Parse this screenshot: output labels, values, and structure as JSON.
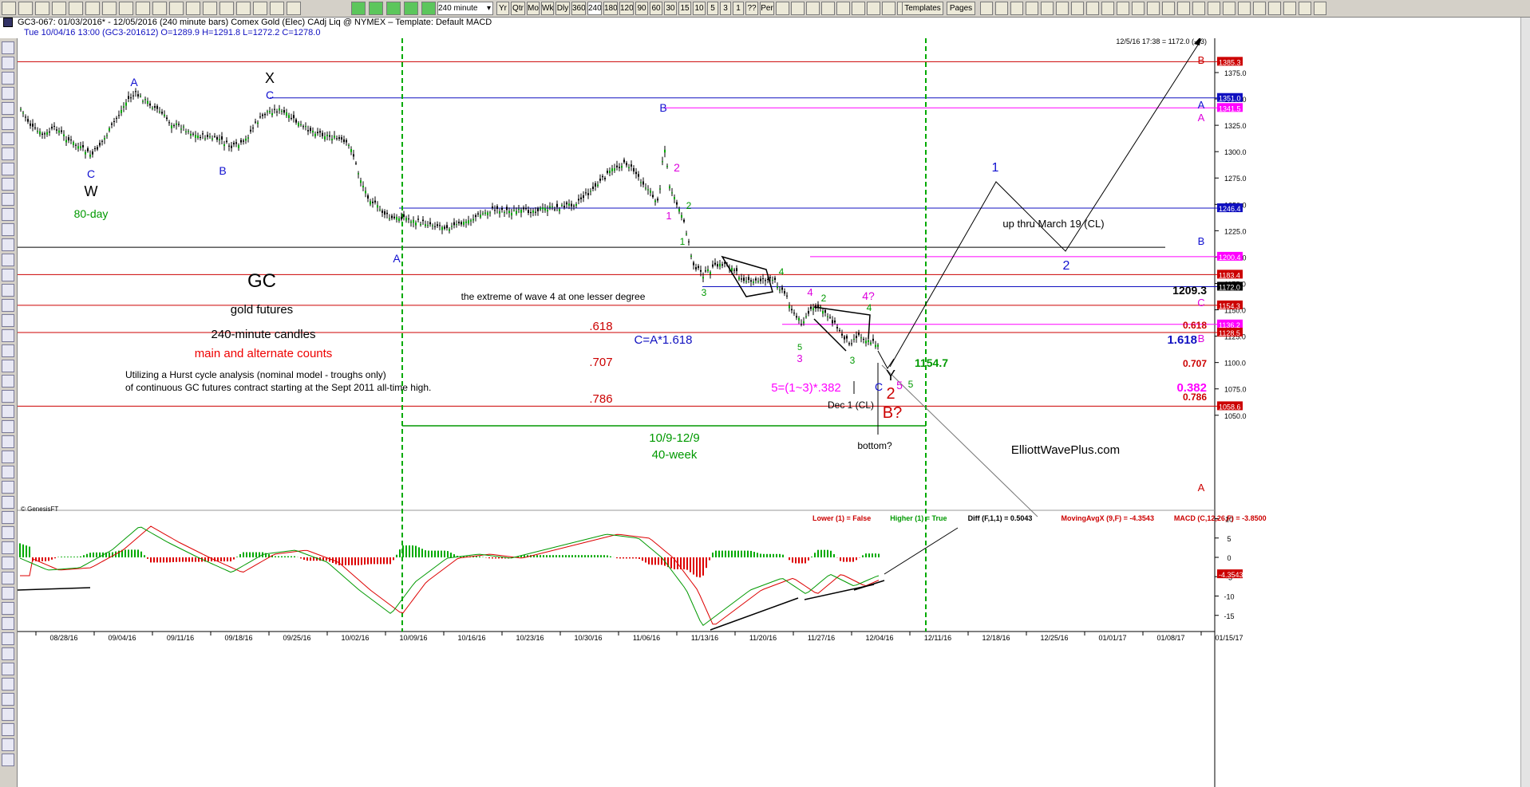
{
  "toolbar": {
    "interval_select": "240 minute",
    "period_buttons": [
      "Yr",
      "Qtr",
      "Mo",
      "Wk",
      "Dly",
      "360",
      "240",
      "180",
      "120",
      "90",
      "60",
      "30",
      "15",
      "10",
      "5",
      "3",
      "1",
      "??",
      "Per"
    ],
    "selected_period": "240",
    "templates_label": "Templates",
    "pages_label": "Pages"
  },
  "title": "GC3-067:  01/03/2016* - 12/05/2016  (240 minute bars)   Comex Gold (Elec) CAdj Liq @ NYMEX  –  Template: Default MACD",
  "info": "Tue   10/04/16 13:00 (GC3-201612)  O=1289.9  H=1291.8  L=1272.2  C=1278.0",
  "timestamp": "12/5/16 17:38 = 1172.0 (-43)",
  "copyright": "© GenesisFT",
  "price_axis": {
    "ticks": [
      {
        "v": 1375,
        "label": "1375.0"
      },
      {
        "v": 1350,
        "label": "1350.0"
      },
      {
        "v": 1325,
        "label": "1325.0"
      },
      {
        "v": 1300,
        "label": "1300.0"
      },
      {
        "v": 1275,
        "label": "1275.0"
      },
      {
        "v": 1250,
        "label": "1250.0"
      },
      {
        "v": 1225,
        "label": "1225.0"
      },
      {
        "v": 1200,
        "label": "1200.0"
      },
      {
        "v": 1175,
        "label": "1175.0"
      },
      {
        "v": 1150,
        "label": "1150.0"
      },
      {
        "v": 1125,
        "label": "1125.0"
      },
      {
        "v": 1100,
        "label": "1100.0"
      },
      {
        "v": 1075,
        "label": "1075.0"
      },
      {
        "v": 1050,
        "label": "1050.0"
      }
    ],
    "flags": [
      {
        "v": 1385.3,
        "label": "1385.3",
        "color": "#cc0000",
        "text": "#ffffff"
      },
      {
        "v": 1351.0,
        "label": "1351.0",
        "color": "#1010c0",
        "text": "#ffffff"
      },
      {
        "v": 1341.5,
        "label": "1341.5",
        "color": "#ff00ff",
        "text": "#ffffff"
      },
      {
        "v": 1246.4,
        "label": "1246.4",
        "color": "#1010c0",
        "text": "#ffffff"
      },
      {
        "v": 1200.4,
        "label": "1200.4",
        "color": "#ff00ff",
        "text": "#ffffff"
      },
      {
        "v": 1183.4,
        "label": "1183.4",
        "color": "#cc0000",
        "text": "#ffffff"
      },
      {
        "v": 1172.0,
        "label": "1172.0",
        "color": "#000000",
        "text": "#ffffff"
      },
      {
        "v": 1154.3,
        "label": "1154.3",
        "color": "#cc0000",
        "text": "#ffffff"
      },
      {
        "v": 1136.2,
        "label": "1136.2",
        "color": "#ff00ff",
        "text": "#ffffff"
      },
      {
        "v": 1128.5,
        "label": "1128.5",
        "color": "#cc0000",
        "text": "#ffffff"
      },
      {
        "v": 1058.6,
        "label": "1058.6",
        "color": "#cc0000",
        "text": "#ffffff"
      }
    ]
  },
  "macd_axis": {
    "ticks": [
      {
        "v": 10,
        "label": "10"
      },
      {
        "v": 5,
        "label": "5"
      },
      {
        "v": 0,
        "label": "0"
      },
      {
        "v": -5,
        "label": "-5"
      },
      {
        "v": -10,
        "label": "-10"
      },
      {
        "v": -15,
        "label": "-15"
      }
    ],
    "flag": {
      "v": -4.3543,
      "label": "-4.3543"
    }
  },
  "dates": [
    "08/28/16",
    "09/04/16",
    "09/11/16",
    "09/18/16",
    "09/25/16",
    "10/02/16",
    "10/09/16",
    "10/16/16",
    "10/23/16",
    "10/30/16",
    "11/06/16",
    "11/13/16",
    "11/20/16",
    "11/27/16",
    "12/04/16",
    "12/11/16",
    "12/18/16",
    "12/25/16",
    "01/01/17",
    "01/08/17",
    "01/15/17"
  ],
  "indicator_legend": [
    {
      "text": "Lower (1) = False",
      "color": "#cc0000"
    },
    {
      "text": "Higher (1) = True",
      "color": "#009900"
    },
    {
      "text": "Diff (F,1,1) = 0.5043",
      "color": "#000000"
    },
    {
      "text": "MovingAvgX (9,F) = -4.3543",
      "color": "#cc0000"
    },
    {
      "text": "MACD (C,12,26,F) = -3.8500",
      "color": "#cc0000"
    }
  ],
  "annotations": {
    "gc": "GC",
    "gold_futures": "gold futures",
    "candles": "240-minute candles",
    "counts": "main and alternate counts",
    "hurst1": "Utilizing a Hurst cycle analysis (nominal model - troughs only)",
    "hurst2": "of continuous GC futures contract starting at the Sept 2011 all-time high.",
    "day80": "80-day",
    "extreme": "the extreme of wave 4 at one lesser degree",
    "lvl1209": "1209.3",
    "fib618": ".618",
    "fib707": ".707",
    "fib786": ".786",
    "fib618r": "0.618",
    "fib707r": "0.707",
    "fib786r": "0.786",
    "fib382r": "0.382",
    "ca": "C=A*1.618",
    "ca_right": "1.618",
    "lvl1154": "1154.7",
    "five_eq": "5=(1~3)*.382",
    "dec1": "Dec 1 (CL)",
    "bgq": "B?",
    "bottom": "bottom?",
    "window": "10/9-12/9",
    "week40": "40-week",
    "up_thru": "up thru March 19 (CL)",
    "site": "ElliottWavePlus.com"
  },
  "wave_labels": [
    {
      "t": "A",
      "c": "#1010d0"
    },
    {
      "t": "C",
      "c": "#1010d0"
    },
    {
      "t": "W",
      "c": "#000"
    },
    {
      "t": "B",
      "c": "#1010d0"
    },
    {
      "t": "X",
      "c": "#000"
    },
    {
      "t": "C",
      "c": "#1010d0"
    },
    {
      "t": "A",
      "c": "#1010d0"
    },
    {
      "t": "B",
      "c": "#1010d0"
    },
    {
      "t": "2",
      "c": "#dd00dd"
    },
    {
      "t": "1",
      "c": "#dd00dd"
    },
    {
      "t": "2",
      "c": "#009900"
    },
    {
      "t": "1",
      "c": "#009900"
    },
    {
      "t": "3",
      "c": "#009900"
    },
    {
      "t": "4",
      "c": "#009900"
    },
    {
      "t": "4",
      "c": "#dd00dd"
    },
    {
      "t": "2",
      "c": "#009900"
    },
    {
      "t": "5",
      "c": "#009900"
    },
    {
      "t": "3",
      "c": "#dd00dd"
    },
    {
      "t": "3",
      "c": "#009900"
    },
    {
      "t": "4?",
      "c": "#dd00dd"
    },
    {
      "t": "4",
      "c": "#009900"
    },
    {
      "t": "Y",
      "c": "#000"
    },
    {
      "t": "2",
      "c": "#cc0000"
    },
    {
      "t": "C",
      "c": "#1010d0"
    },
    {
      "t": "5",
      "c": "#dd00dd"
    },
    {
      "t": "5",
      "c": "#009900"
    },
    {
      "t": "1",
      "c": "#1010d0"
    },
    {
      "t": "2",
      "c": "#1010d0"
    },
    {
      "t": "B",
      "c": "#cc0000"
    },
    {
      "t": "A",
      "c": "#1010d0"
    },
    {
      "t": "A",
      "c": "#dd00dd"
    },
    {
      "t": "B",
      "c": "#1010d0"
    },
    {
      "t": "C",
      "c": "#dd00dd"
    },
    {
      "t": "B",
      "c": "#dd00dd"
    },
    {
      "t": "A",
      "c": "#cc0000"
    }
  ],
  "colors": {
    "red": "#cc0000",
    "blue": "#1010c0",
    "magenta": "#ff00ff",
    "green": "#009900",
    "black": "#000000"
  }
}
